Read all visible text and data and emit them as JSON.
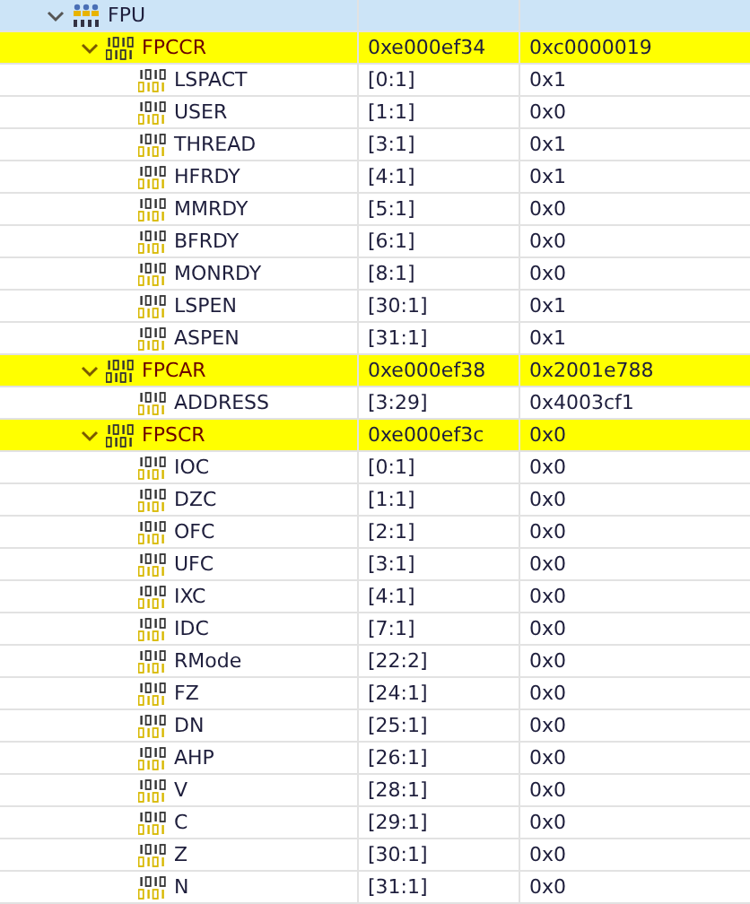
{
  "peripheral": {
    "name": "FPU",
    "expanded": true,
    "selected": true,
    "registers": [
      {
        "name": "FPCCR",
        "address": "0xe000ef34",
        "value": "0xc0000019",
        "expanded": true,
        "highlighted": true,
        "fields": [
          {
            "name": "LSPACT",
            "bits": "[0:1]",
            "value": "0x1"
          },
          {
            "name": "USER",
            "bits": "[1:1]",
            "value": "0x0"
          },
          {
            "name": "THREAD",
            "bits": "[3:1]",
            "value": "0x1"
          },
          {
            "name": "HFRDY",
            "bits": "[4:1]",
            "value": "0x1"
          },
          {
            "name": "MMRDY",
            "bits": "[5:1]",
            "value": "0x0"
          },
          {
            "name": "BFRDY",
            "bits": "[6:1]",
            "value": "0x0"
          },
          {
            "name": "MONRDY",
            "bits": "[8:1]",
            "value": "0x0"
          },
          {
            "name": "LSPEN",
            "bits": "[30:1]",
            "value": "0x1"
          },
          {
            "name": "ASPEN",
            "bits": "[31:1]",
            "value": "0x1"
          }
        ]
      },
      {
        "name": "FPCAR",
        "address": "0xe000ef38",
        "value": "0x2001e788",
        "expanded": true,
        "highlighted": true,
        "fields": [
          {
            "name": "ADDRESS",
            "bits": "[3:29]",
            "value": "0x4003cf1"
          }
        ]
      },
      {
        "name": "FPSCR",
        "address": "0xe000ef3c",
        "value": "0x0",
        "expanded": true,
        "highlighted": true,
        "fields": [
          {
            "name": "IOC",
            "bits": "[0:1]",
            "value": "0x0"
          },
          {
            "name": "DZC",
            "bits": "[1:1]",
            "value": "0x0"
          },
          {
            "name": "OFC",
            "bits": "[2:1]",
            "value": "0x0"
          },
          {
            "name": "UFC",
            "bits": "[3:1]",
            "value": "0x0"
          },
          {
            "name": "IXC",
            "bits": "[4:1]",
            "value": "0x0"
          },
          {
            "name": "IDC",
            "bits": "[7:1]",
            "value": "0x0"
          },
          {
            "name": "RMode",
            "bits": "[22:2]",
            "value": "0x0"
          },
          {
            "name": "FZ",
            "bits": "[24:1]",
            "value": "0x0"
          },
          {
            "name": "DN",
            "bits": "[25:1]",
            "value": "0x0"
          },
          {
            "name": "AHP",
            "bits": "[26:1]",
            "value": "0x0"
          },
          {
            "name": "V",
            "bits": "[28:1]",
            "value": "0x0"
          },
          {
            "name": "C",
            "bits": "[29:1]",
            "value": "0x0"
          },
          {
            "name": "Z",
            "bits": "[30:1]",
            "value": "0x0"
          },
          {
            "name": "N",
            "bits": "[31:1]",
            "value": "0x0"
          }
        ]
      }
    ]
  }
}
